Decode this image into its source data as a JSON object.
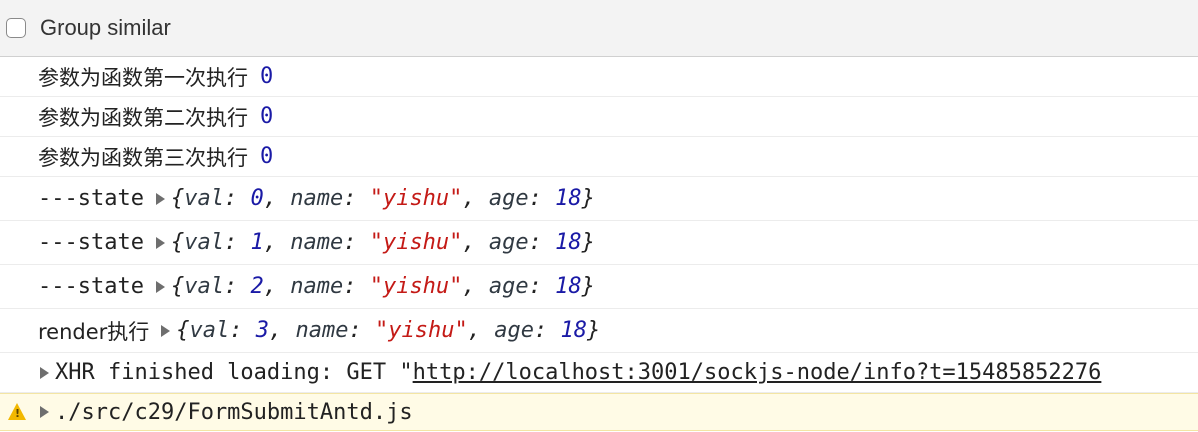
{
  "toolbar": {
    "group_similar_label": "Group similar",
    "group_similar_checked": false
  },
  "logs": [
    {
      "text": "参数为函数第一次执行",
      "value": "0"
    },
    {
      "text": "参数为函数第二次执行",
      "value": "0"
    },
    {
      "text": "参数为函数第三次执行",
      "value": "0"
    }
  ],
  "state_rows": [
    {
      "label": "---state",
      "val": "0",
      "name": "\"yishu\"",
      "age": "18"
    },
    {
      "label": "---state",
      "val": "1",
      "name": "\"yishu\"",
      "age": "18"
    },
    {
      "label": "---state",
      "val": "2",
      "name": "\"yishu\"",
      "age": "18"
    }
  ],
  "render_row": {
    "label": "render执行",
    "val": "3",
    "name": "\"yishu\"",
    "age": "18"
  },
  "object_keys": {
    "open": "{",
    "val": "val",
    "name": "name",
    "age": "age",
    "colon": ":",
    "comma": ",",
    "close": "}"
  },
  "xhr_row": {
    "prefix": "XHR finished loading: GET \"",
    "url": "http://localhost:3001/sockjs-node/info?t=15485852276"
  },
  "warning_row": {
    "text": "./src/c29/FormSubmitAntd.js"
  },
  "colors": {
    "number": "#1a1aa6",
    "string": "#c41a16",
    "warning_bg": "#fffbe6",
    "warning_icon": "#f2b800"
  }
}
